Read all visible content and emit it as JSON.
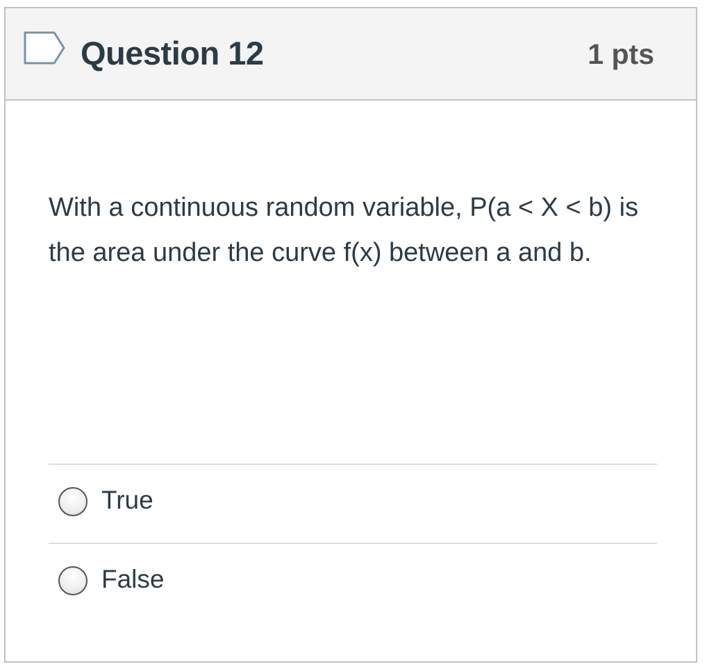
{
  "question": {
    "title": "Question 12",
    "points": "1 pts",
    "flag_icon": "bookmark-flag-icon",
    "text": "With a continuous random variable, P(a < X < b) is the area under the curve f(x) between a and b."
  },
  "answers": [
    {
      "label": "True",
      "selected": false
    },
    {
      "label": "False",
      "selected": false
    }
  ],
  "colors": {
    "header_bg": "#f4f4f4",
    "border": "#c2c2c2",
    "text": "#2d3b45",
    "points": "#555555",
    "flag_outline": "#7a93a8"
  }
}
